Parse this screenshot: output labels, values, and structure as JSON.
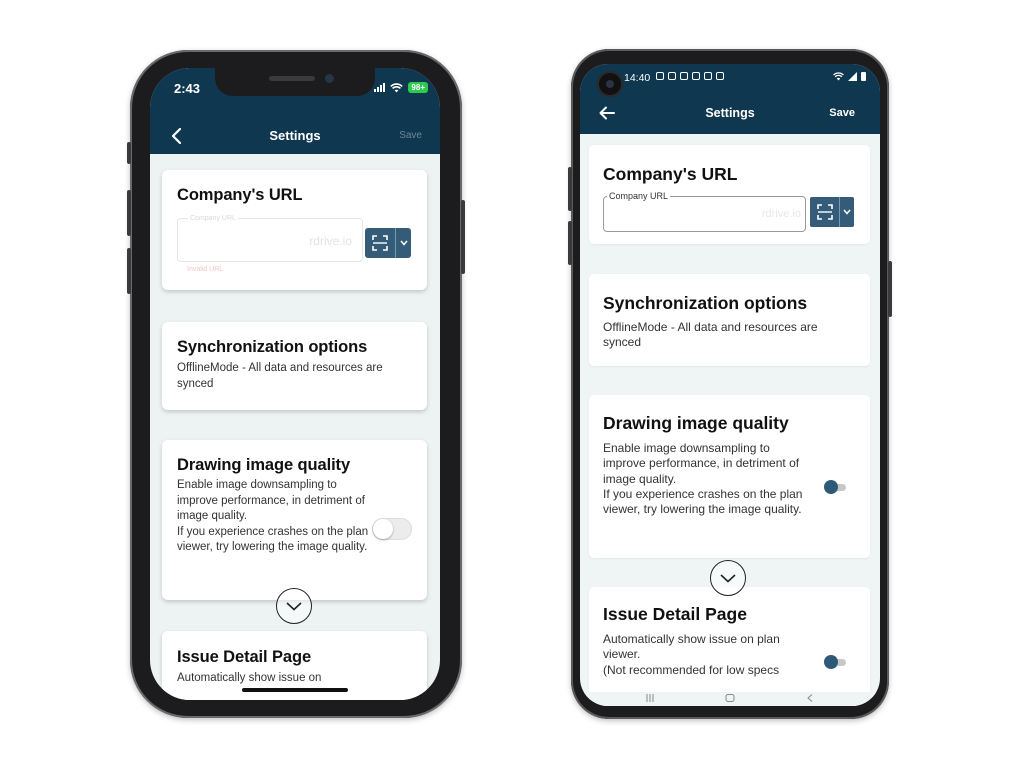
{
  "ios": {
    "status": {
      "time": "2:43",
      "battery": "98+"
    },
    "header": {
      "title": "Settings",
      "save_label": "Save"
    },
    "company_url": {
      "title": "Company's URL",
      "field_label": "Company URL",
      "field_value": "rdrive.io",
      "helper": "Invalid URL"
    },
    "sync": {
      "title": "Synchronization options",
      "description": "OfflineMode - All data and resources are synced"
    },
    "drawing": {
      "title": "Drawing image quality",
      "description": "Enable image downsampling to improve performance, in detriment of image quality.\nIf you experience crashes on the plan viewer, try lowering the image quality.",
      "toggle_on": false
    },
    "issue": {
      "title": "Issue Detail Page",
      "description": "Automatically show issue on"
    }
  },
  "android": {
    "status": {
      "time": "14:40"
    },
    "header": {
      "title": "Settings",
      "save_label": "Save"
    },
    "company_url": {
      "title": "Company's URL",
      "field_label": "Company URL",
      "field_value": "rdrive.io"
    },
    "sync": {
      "title": "Synchronization options",
      "description": "OfflineMode - All data and resources are synced"
    },
    "drawing": {
      "title": "Drawing image quality",
      "description": "Enable image downsampling to improve performance, in detriment of image quality.\nIf you experience crashes on the plan viewer, try lowering the image quality.",
      "toggle_on": true
    },
    "issue": {
      "title": "Issue Detail Page",
      "description": "Automatically show issue on plan viewer.\n(Not recommended for low specs",
      "toggle_on": true
    }
  },
  "colors": {
    "header_bg": "#0f3750",
    "accent": "#345c79",
    "screen_bg": "#ecf3f2"
  },
  "icons": [
    "back-chevron-icon",
    "qr-scan-icon",
    "chevron-down-icon",
    "scroll-down-icon"
  ]
}
